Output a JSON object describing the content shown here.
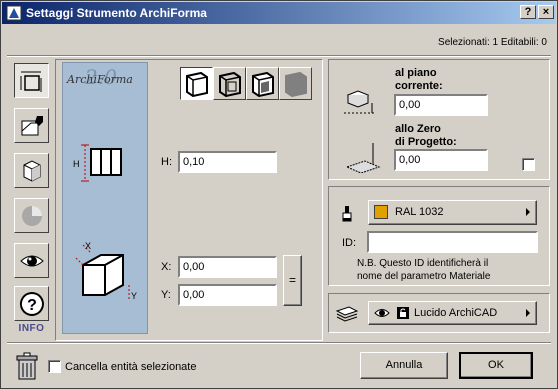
{
  "window": {
    "title": "Settaggi Strumento ArchiForma",
    "help_btn": "?",
    "close_btn": "×"
  },
  "selection": "Selezionati: 1  Editabili: 0",
  "sidebar": {
    "info_label": "INFO",
    "tabs": [
      "geometry",
      "floor-plan",
      "model",
      "shading",
      "view",
      "help"
    ]
  },
  "logo": {
    "text": "ArchiForma",
    "version": "2.0"
  },
  "geometry": {
    "h_label": "H:",
    "h_value": "0,10",
    "x_label": "X:",
    "x_value": "0,00",
    "y_label": "Y:",
    "y_value": "0,00",
    "link_btn": "="
  },
  "elevation": {
    "story_label_1": "al piano",
    "story_label_2": "corrente:",
    "story_value": "0,00",
    "zero_label_1": "allo Zero",
    "zero_label_2": "di Progetto:",
    "zero_value": "0,00"
  },
  "material": {
    "name": "RAL 1032",
    "swatch_color": "#e0a000",
    "id_label": "ID:",
    "id_value": "",
    "note_1": "N.B. Questo ID identificherà il",
    "note_2": "nome del parametro Materiale"
  },
  "layer": {
    "name": "Lucido ArchiCAD"
  },
  "footer": {
    "delete_label": "Cancella entità selezionate",
    "cancel_btn": "Annulla",
    "ok_btn": "OK"
  }
}
